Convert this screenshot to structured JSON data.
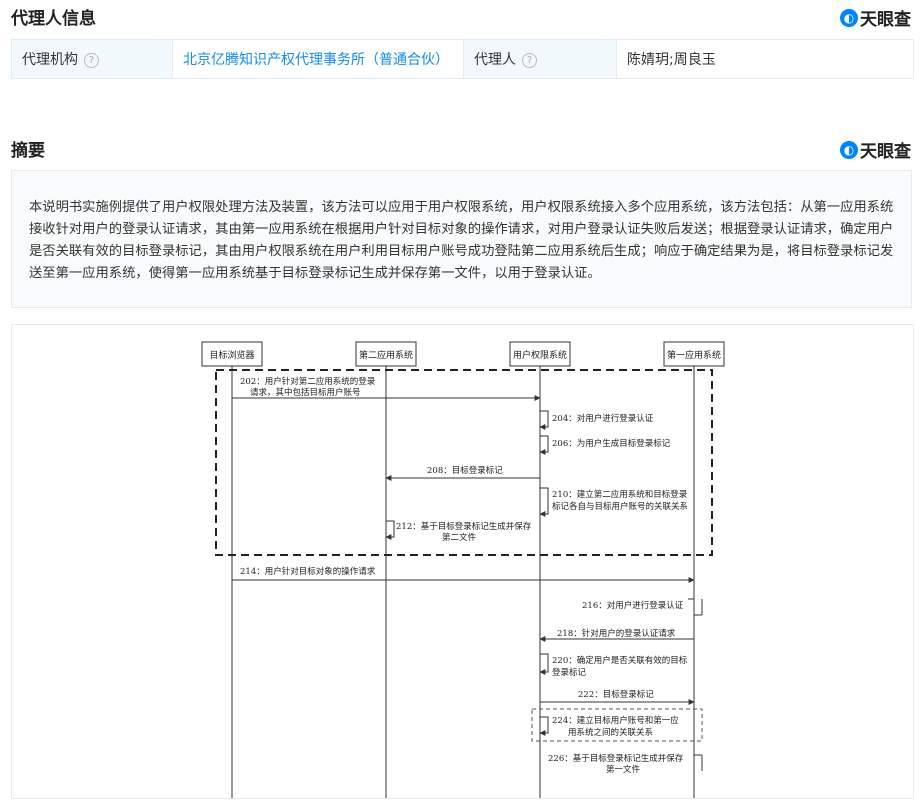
{
  "agent_section": {
    "title": "代理人信息",
    "brand": "天眼查",
    "agency_label": "代理机构",
    "agency_value": "北京亿腾知识产权代理事务所（普通合伙）",
    "agent_label": "代理人",
    "agent_value": "陈婧玥;周良玉"
  },
  "abstract_section": {
    "title": "摘要",
    "brand": "天眼查",
    "text": "本说明书实施例提供了用户权限处理方法及装置，该方法可以应用于用户权限系统，用户权限系统接入多个应用系统，该方法包括：从第一应用系统接收针对用户的登录认证请求，其由第一应用系统在根据用户针对目标对象的操作请求，对用户登录认证失败后发送；根据登录认证请求，确定用户是否关联有效的目标登录标记，其由用户权限系统在用户利用目标用户账号成功登陆第二应用系统后生成；响应于确定结果为是，将目标登录标记发送至第一应用系统，使得第一应用系统基于目标登录标记生成并保存第一文件，以用于登录认证。"
  },
  "diagram": {
    "lanes": [
      "目标浏览器",
      "第二应用系统",
      "用户权限系统",
      "第一应用系统"
    ],
    "steps": {
      "s202a": "202：用户针对第二应用系统的登录",
      "s202b": "请求，其中包括目标用户账号",
      "s204": "204：对用户进行登录认证",
      "s206": "206：为用户生成目标登录标记",
      "s208": "208：目标登录标记",
      "s210a": "210：建立第二应用系统和目标登录",
      "s210b": "标记各自与目标用户账号的关联关系",
      "s212a": "212：基于目标登录标记生成并保存",
      "s212b": "第二文件",
      "s214": "214：用户针对目标对象的操作请求",
      "s216": "216：对用户进行登录认证",
      "s218": "218：针对用户的登录认证请求",
      "s220a": "220：确定用户是否关联有效的目标",
      "s220b": "登录标记",
      "s222": "222：目标登录标记",
      "s224a": "224：建立目标用户账号和第一应",
      "s224b": "用系统之间的关联关系",
      "s226a": "226：基于目标登录标记生成并保存",
      "s226b": "第一文件"
    }
  }
}
